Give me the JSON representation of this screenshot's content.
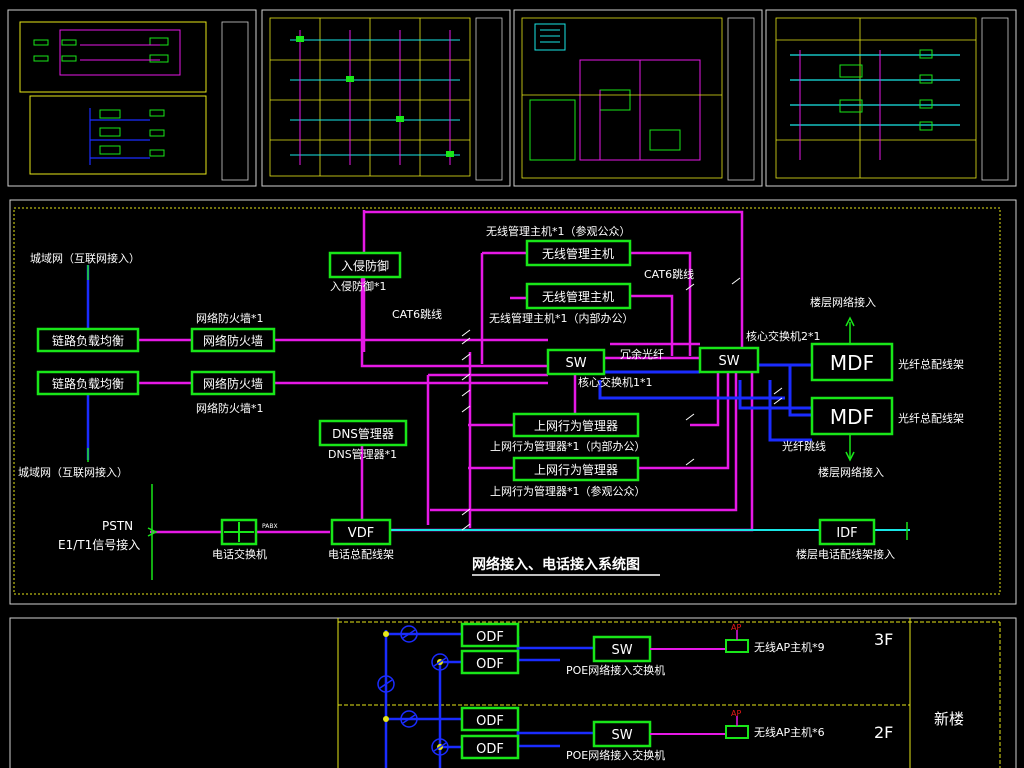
{
  "thumbnails": [
    {
      "id": "sheet-1"
    },
    {
      "id": "sheet-2"
    },
    {
      "id": "sheet-3"
    },
    {
      "id": "sheet-4"
    }
  ],
  "diagram": {
    "title": "网络接入、电话接入系统图",
    "wan_top": "城域网（互联网接入）",
    "wan_bottom": "城域网（互联网接入）",
    "load_balancer": "链路负载均衡",
    "firewall": "网络防火墙",
    "firewall_caption": "网络防火墙*1",
    "ids": "入侵防御",
    "ids_caption": "入侵防御*1",
    "cat6_left": "CAT6跳线",
    "cat6_right": "CAT6跳线",
    "wireless_public_caption": "无线管理主机*1（参观公众）",
    "wireless_public": "无线管理主机",
    "wireless_office": "无线管理主机",
    "wireless_office_caption": "无线管理主机*1（内部办公）",
    "sw_core1": "SW",
    "sw_core1_caption": "核心交换机1*1",
    "redundant_fiber": "冗余光纤",
    "sw_core2": "SW",
    "sw_core2_caption": "核心交换机2*1",
    "floor_network_top": "楼层网络接入",
    "mdf": "MDF",
    "mdf_caption": "光纤总配线架",
    "fiber_jumper": "光纤跳线",
    "floor_network_bottom": "楼层网络接入",
    "dns": "DNS管理器",
    "dns_caption": "DNS管理器*1",
    "behavior_office": "上网行为管理器",
    "behavior_office_caption": "上网行为管理器*1（内部办公）",
    "behavior_public": "上网行为管理器",
    "behavior_public_caption": "上网行为管理器*1（参观公众）",
    "pstn": "PSTN",
    "pstn_line2": "E1/T1信号接入",
    "pabx": "PABX",
    "phone_switch_caption": "电话交换机",
    "vdf": "VDF",
    "vdf_caption": "电话总配线架",
    "idf": "IDF",
    "idf_caption": "楼层电话配线架接入"
  },
  "floors": {
    "building": "新楼",
    "rows": [
      {
        "floor": "3F",
        "odf": "ODF",
        "sw": "SW",
        "poe": "POE网络接入交换机",
        "ap": "无线AP主机*9",
        "ap_tag": "AP"
      },
      {
        "floor": "2F",
        "odf": "ODF",
        "sw": "SW",
        "poe": "POE网络接入交换机",
        "ap": "无线AP主机*6",
        "ap_tag": "AP"
      }
    ]
  },
  "colors": {
    "green": "#19e619",
    "magenta": "#e619e6",
    "blue": "#1a2cff",
    "cyan": "#19e6e6",
    "yellow": "#e6e619",
    "white": "#ffffff"
  }
}
